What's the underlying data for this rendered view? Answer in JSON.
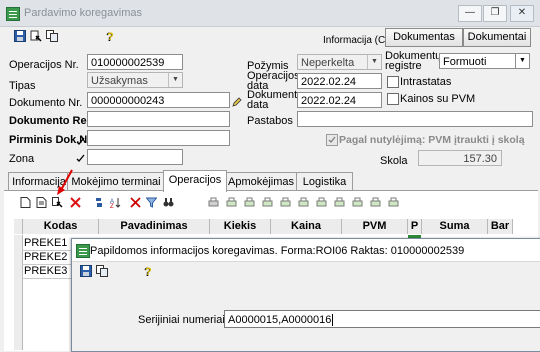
{
  "window": {
    "title": "Pardavimo koregavimas",
    "controls": [
      "minimize",
      "restore",
      "close"
    ]
  },
  "toolbar": {
    "icons": [
      "save-icon",
      "tools-icon",
      "copy-icon",
      "help-icon"
    ],
    "info_text": "Informacija (Ctrl-...",
    "btn_dokumentas": "Dokumentas",
    "btn_dokumentai": "Dokumentai"
  },
  "form": {
    "operacijos_nr_label": "Operacijos Nr.",
    "operacijos_nr_value": "010000002539",
    "tipas_label": "Tipas",
    "tipas_value": "Užsakymas",
    "dokumento_nr_label": "Dokumento Nr.",
    "dokumento_nr_value": "000000000243",
    "dokumento_reg_label": "Dokumento Reg.",
    "dokumento_reg_value": "",
    "pirminis_label": "Pirminis Dok.Nr.",
    "pirminis_value": "",
    "zona_label": "Zona",
    "zona_value": "",
    "pozymis_label": "Požymis",
    "pozymis_value": "Neperkelta",
    "operacijos_data_label_1": "Operacijos",
    "operacijos_data_label_2": "data",
    "operacijos_data_value": "2022.02.24",
    "dokumento_data_label_1": "Dokumento",
    "dokumento_data_label_2": "data",
    "dokumento_data_value": "2022.02.24",
    "dokumentu_registre_label_1": "Dokumentų",
    "dokumentu_registre_label_2": "registre",
    "dokumentu_registre_value": "Formuoti",
    "intrastatas_label": "Intrastatas",
    "kainos_su_pvm_label": "Kainos su PVM",
    "pastabos_label": "Pastabos",
    "pastabos_value": "",
    "pagal_nutylejima_label": "Pagal nutylėjimą: PVM įtraukti į skolą",
    "skola_label": "Skola",
    "skola_value": "157.30"
  },
  "tabs": [
    "Informacija",
    "Mokėjimo terminai",
    "Operacijos",
    "Apmokėjimas",
    "Logistika"
  ],
  "active_tab": "Operacijos",
  "grid": {
    "headers": [
      "Kodas",
      "Pavadinimas",
      "Kiekis",
      "Kaina",
      "PVM",
      "P",
      "Suma",
      "Bar"
    ],
    "rows": [
      "PREKE1",
      "PREKE2",
      "PREKE3"
    ]
  },
  "dialog": {
    "title": "Papildomos informacijos koregavimas. Forma:ROI06 Raktas: 010000002539",
    "serijiniai_label": "Serijiniai numeriai",
    "serijiniai_value": "A0000015,A0000016"
  },
  "colors": {
    "arrow": "#e00000",
    "titlebar": "#dfe3e8",
    "checkbox_checked": "#808080"
  }
}
